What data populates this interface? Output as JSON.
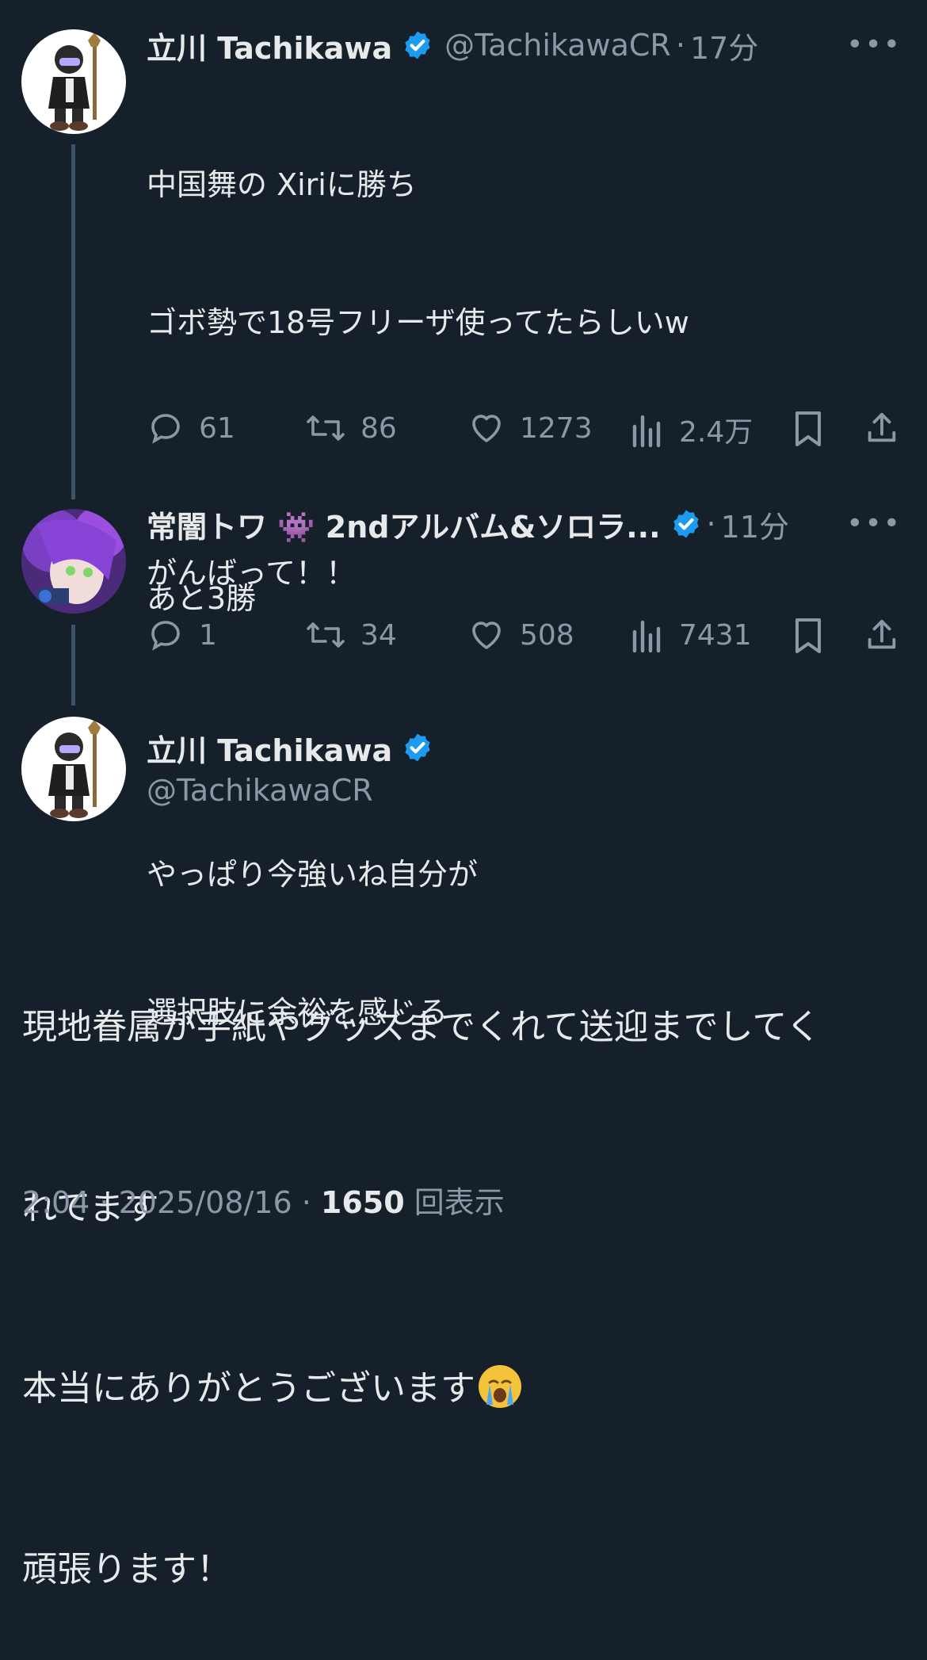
{
  "tweet1": {
    "name": "立川 Tachikawa",
    "handle": "@TachikawaCR",
    "time": "17分",
    "more": "•••",
    "lines": [
      "中国舞の Xiriに勝ち",
      "ゴボ勢で18号フリーザ使ってたらしいw",
      "",
      "あと3勝",
      "",
      "やっぱり今強いね自分が",
      "選択肢に余裕を感じる"
    ],
    "replies": "61",
    "retweets": "86",
    "likes": "1273",
    "views": "2.4万"
  },
  "tweet2": {
    "name": "常闇トワ 👾 2ndアルバム&ソロラ...",
    "time": "11分",
    "more": "•••",
    "text": "がんばって！！",
    "replies": "1",
    "retweets": "34",
    "likes": "508",
    "views": "7431"
  },
  "main": {
    "name": "立川 Tachikawa",
    "handle": "@TachikawaCR",
    "lines": [
      "現地眷属が手紙やグッズまでくれて送迎までしてく",
      "れてます",
      "本当にありがとうございます",
      "頑張ります！"
    ],
    "emoji": "crying-face",
    "time": "2:04",
    "date": "2025/08/16",
    "views_count": "1650",
    "views_label": "回表示"
  },
  "colors": {
    "background": "#15202b",
    "verified": "#1d9bf0",
    "secondary": "#8b98a5"
  }
}
